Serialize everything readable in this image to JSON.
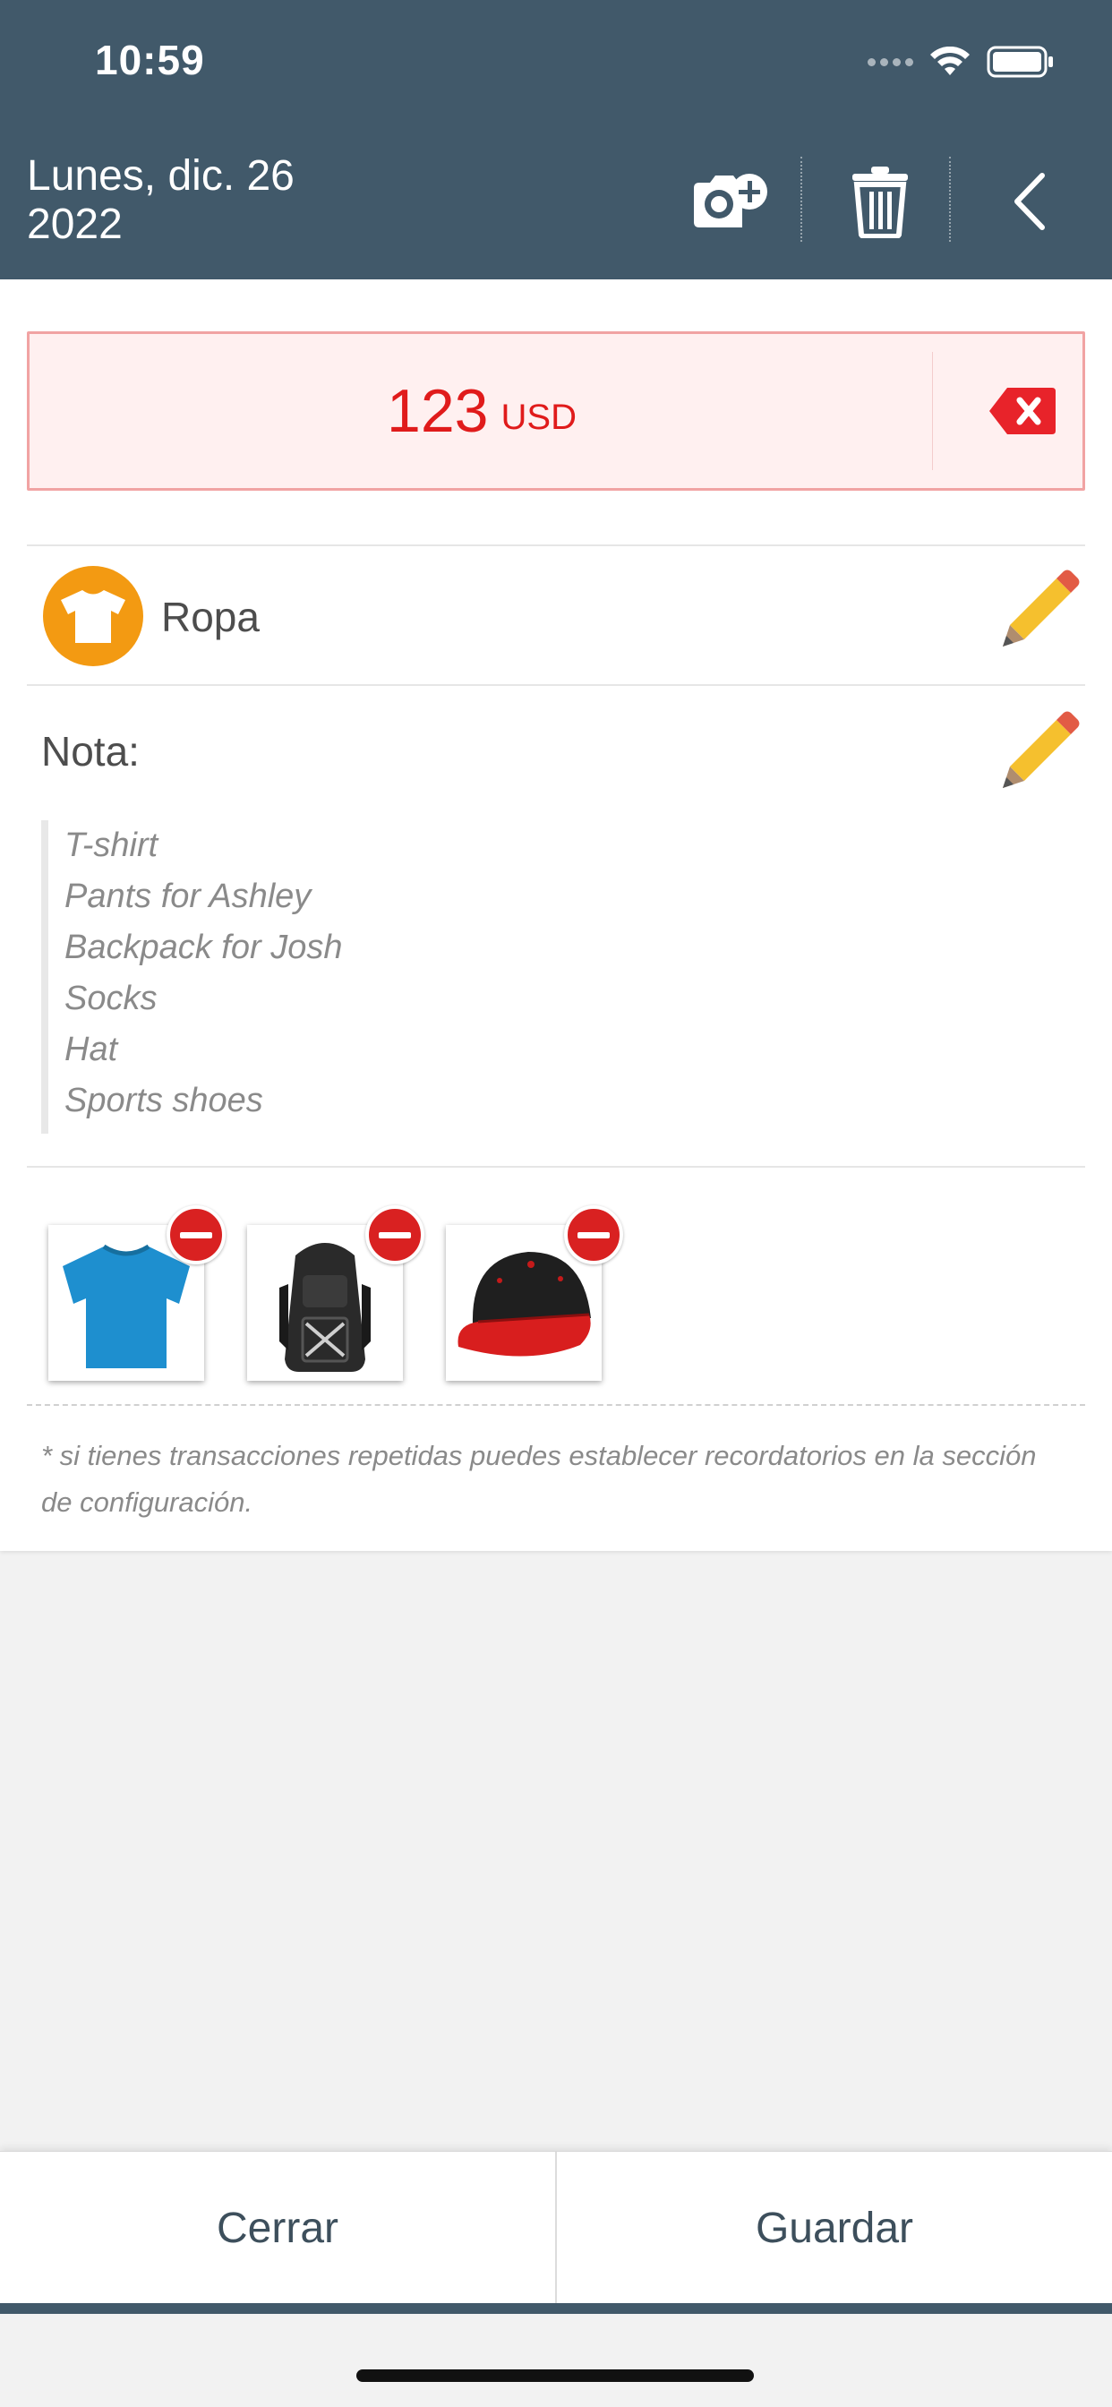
{
  "status_bar": {
    "time": "10:59"
  },
  "header": {
    "date_line1": "Lunes, dic. 26",
    "date_line2": "2022",
    "icons": [
      "camera-add-icon",
      "trash-icon",
      "back-chevron-icon"
    ]
  },
  "amount": {
    "value": "123",
    "currency": "USD",
    "color": "#e01b1b"
  },
  "category": {
    "label": "Ropa",
    "icon": "tshirt-icon",
    "icon_color": "#f39a12"
  },
  "note": {
    "label": "Nota:",
    "lines": [
      "T-shirt",
      "Pants for Ashley",
      "Backpack for Josh",
      "Socks",
      "Hat",
      "Sports shoes"
    ]
  },
  "photos": [
    {
      "name": "tshirt-photo"
    },
    {
      "name": "backpack-photo"
    },
    {
      "name": "cap-photo"
    }
  ],
  "hint": "* si tienes transacciones repetidas puedes establecer recordatorios en la sección de configuración.",
  "footer": {
    "close_label": "Cerrar",
    "save_label": "Guardar"
  },
  "colors": {
    "header_bg": "#41596a",
    "accent_red": "#d92121"
  }
}
